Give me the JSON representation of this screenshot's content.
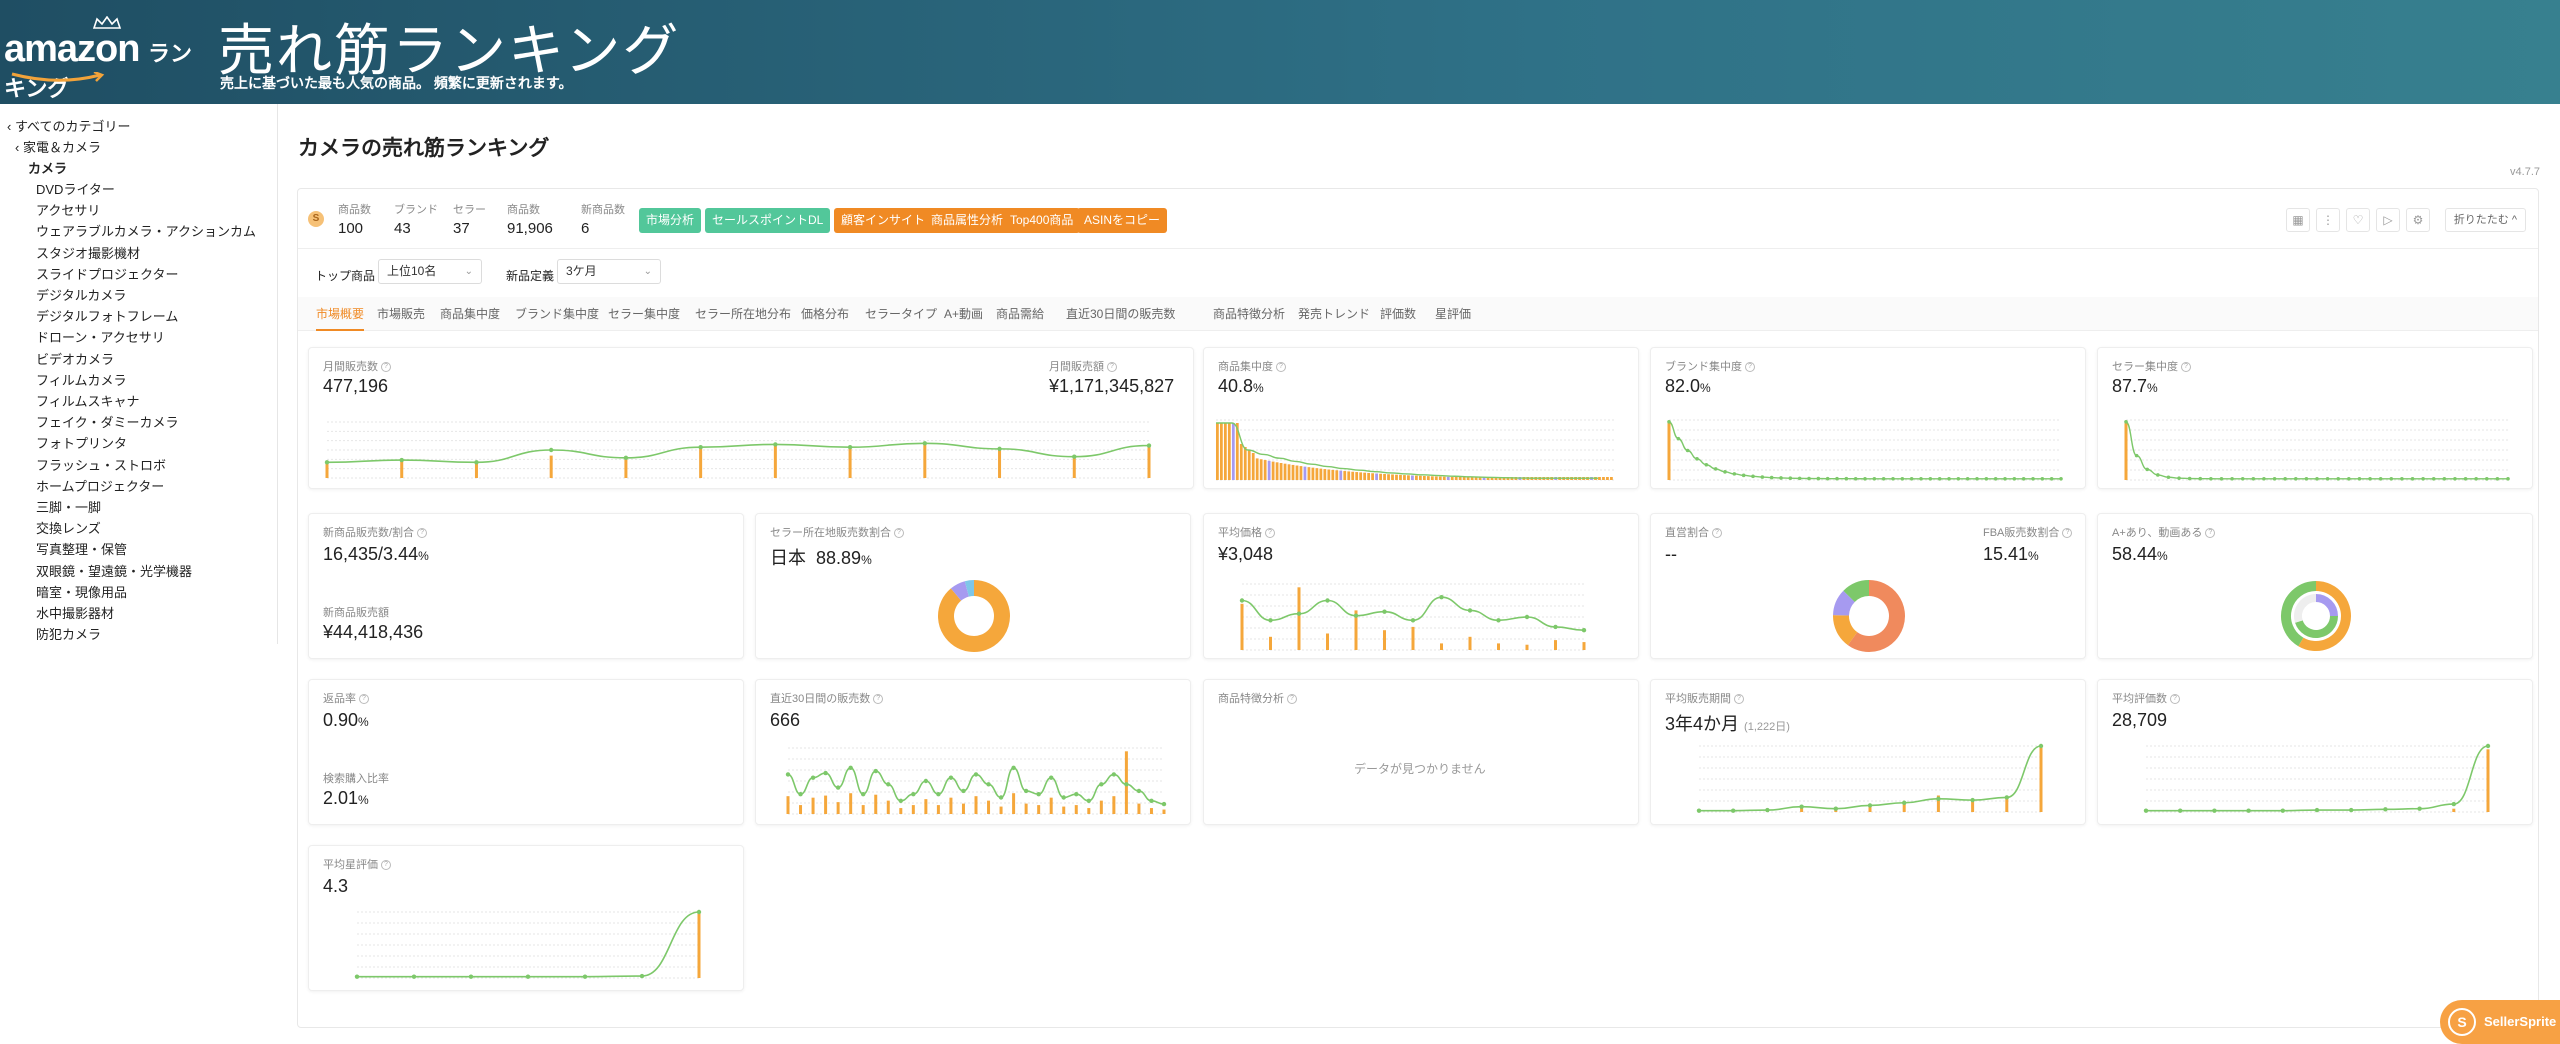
{
  "banner": {
    "logo_amazon": "amazon",
    "logo_ranking": "ランキング",
    "title": "売れ筋ランキング",
    "subtitle": "売上に基づいた最も人気の商品。 頻繁に更新されます。"
  },
  "sidebar": {
    "all_categories": "‹ すべてのカテゴリー",
    "parent": "‹ 家電＆カメラ",
    "current": "カメラ",
    "items": [
      "DVDライター",
      "アクセサリ",
      "ウェアラブルカメラ・アクションカム",
      "スタジオ撮影機材",
      "スライドプロジェクター",
      "デジタルカメラ",
      "デジタルフォトフレーム",
      "ドローン・アクセサリ",
      "ビデオカメラ",
      "フィルムカメラ",
      "フィルムスキャナ",
      "フェイク・ダミーカメラ",
      "フォトプリンタ",
      "フラッシュ・ストロボ",
      "ホームプロジェクター",
      "三脚・一脚",
      "交換レンズ",
      "写真整理・保管",
      "双眼鏡・望遠鏡・光学機器",
      "暗室・現像用品",
      "水中撮影器材",
      "防犯カメラ"
    ]
  },
  "main": {
    "title": "カメラの売れ筋ランキング",
    "version": "v4.7.7"
  },
  "stats": {
    "icon": "s-icon",
    "items": [
      {
        "label": "商品数",
        "value": "100"
      },
      {
        "label": "ブランド",
        "value": "43"
      },
      {
        "label": "セラー",
        "value": "37"
      },
      {
        "label": "商品数",
        "value": "91,906"
      },
      {
        "label": "新商品数",
        "value": "6"
      }
    ],
    "buttons": [
      {
        "label": "市場分析",
        "color": "#52c79a"
      },
      {
        "label": "セールスポイントDL",
        "color": "#52c79a"
      },
      {
        "label": "顧客インサイト",
        "color": "#f08a24"
      },
      {
        "label": "商品属性分析",
        "color": "#f08a24"
      },
      {
        "label": "Top400商品",
        "color": "#f08a24"
      },
      {
        "label": "ASINをコピー",
        "color": "#f08a24"
      }
    ],
    "right_icons": [
      "grid-icon",
      "more-icon",
      "heart-icon",
      "video-icon",
      "settings-icon"
    ],
    "fold_label": "折りたたむ ^"
  },
  "filters": {
    "top_label": "トップ商品",
    "top_value": "上位10名",
    "new_label": "新品定義",
    "new_value": "3ケ月"
  },
  "tabs": [
    "市場概要",
    "市場販売",
    "商品集中度",
    "ブランド集中度",
    "セラー集中度",
    "セラー所在地分布",
    "価格分布",
    "セラータイプ",
    "A+動画",
    "商品需給",
    "直近30日間の販売数",
    "商品特徴分析",
    "発売トレンド",
    "評価数",
    "星評価"
  ],
  "cards": {
    "monthly_sales_label": "月間販売数",
    "monthly_sales_value": "477,196",
    "monthly_revenue_label": "月間販売額",
    "monthly_revenue_value": "¥1,171,345,827",
    "product_conc_label": "商品集中度",
    "product_conc_value": "40.8",
    "brand_conc_label": "ブランド集中度",
    "brand_conc_value": "82.0",
    "seller_conc_label": "セラー集中度",
    "seller_conc_value": "87.7",
    "new_sales_label": "新商品販売数/割合",
    "new_sales_value": "16,435/3.44",
    "new_revenue_label": "新商品販売額",
    "new_revenue_value": "¥44,418,436",
    "seller_loc_label": "セラー所在地販売数割合",
    "seller_loc_country": "日本",
    "seller_loc_value": "88.89",
    "avg_price_label": "平均価格",
    "avg_price_value": "¥3,048",
    "direct_label": "直営割合",
    "direct_value": "--",
    "fba_label": "FBA販売数割合",
    "fba_value": "15.41",
    "aplus_label": "A+あり、動画ある",
    "aplus_value": "58.44",
    "return_label": "返品率",
    "return_value": "0.90",
    "search_label": "検索購入比率",
    "search_value": "2.01",
    "recent30_label": "直近30日間の販売数",
    "recent30_value": "666",
    "feature_label": "商品特徴分析",
    "feature_nodata": "データが見つかりません",
    "avg_period_label": "平均販売期間",
    "avg_period_value": "3年4か月",
    "avg_period_days": "(1,222日)",
    "avg_reviews_label": "平均評価数",
    "avg_reviews_value": "28,709",
    "avg_rating_label": "平均星評価",
    "avg_rating_value": "4.3",
    "percent_unit": "%"
  },
  "colors": {
    "orange": "#f5a73b",
    "green": "#7dc86a",
    "purple": "#a69af0",
    "coral": "#f08a5d",
    "grid": "#e6e6e6"
  },
  "seller_sprite": {
    "icon": "s-logo-icon",
    "label": "SellerSprite"
  }
}
